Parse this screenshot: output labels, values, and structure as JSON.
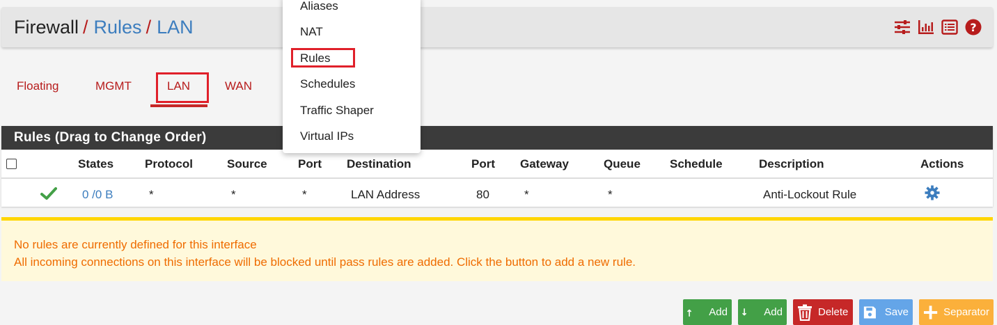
{
  "breadcrumb": {
    "first": "Firewall",
    "sep": "/",
    "second": "Rules",
    "third": "LAN"
  },
  "header_icons": [
    "sliders-icon",
    "bar-chart-icon",
    "list-icon",
    "help-icon"
  ],
  "tabs": [
    {
      "label": "Floating"
    },
    {
      "label": "MGMT"
    },
    {
      "label": "LAN",
      "active": true
    },
    {
      "label": "WAN"
    }
  ],
  "dropdown": {
    "items": [
      "Aliases",
      "NAT",
      "Rules",
      "Schedules",
      "Traffic Shaper",
      "Virtual IPs"
    ],
    "highlighted": "Rules"
  },
  "panel": {
    "heading": "Rules (Drag to Change Order)"
  },
  "table": {
    "columns": [
      "States",
      "Protocol",
      "Source",
      "Port",
      "Destination",
      "Port",
      "Gateway",
      "Queue",
      "Schedule",
      "Description",
      "Actions"
    ],
    "rows": [
      {
        "status_icon": "check-icon",
        "states": "0 /0 B",
        "protocol": "*",
        "source": "*",
        "port": "*",
        "destination": "LAN Address",
        "dest_port": "80",
        "gateway": "*",
        "queue": "*",
        "schedule": "",
        "description": "Anti-Lockout Rule",
        "action_icon": "gear-icon"
      }
    ]
  },
  "alert": {
    "line1": "No rules are currently defined for this interface",
    "line2": "All incoming connections on this interface will be blocked until pass rules are added. Click the button to add a new rule."
  },
  "buttons": [
    {
      "label": "Add",
      "icon": "arrow-up-icon",
      "color": "#43a047"
    },
    {
      "label": "Add",
      "icon": "arrow-down-icon",
      "color": "#43a047"
    },
    {
      "label": "Delete",
      "icon": "trash-icon",
      "color": "#c62828"
    },
    {
      "label": "Save",
      "icon": "save-icon",
      "color": "#64a5e8"
    },
    {
      "label": "Separator",
      "icon": "plus-icon",
      "color": "#fbb03b"
    }
  ],
  "colors": {
    "accent_red": "#b71c1c",
    "link_blue": "#3c7dbe",
    "panel_dark": "#3b3b3b",
    "alert_bg": "#fff9db",
    "alert_border": "#ffd600",
    "alert_text": "#ef6c00"
  }
}
